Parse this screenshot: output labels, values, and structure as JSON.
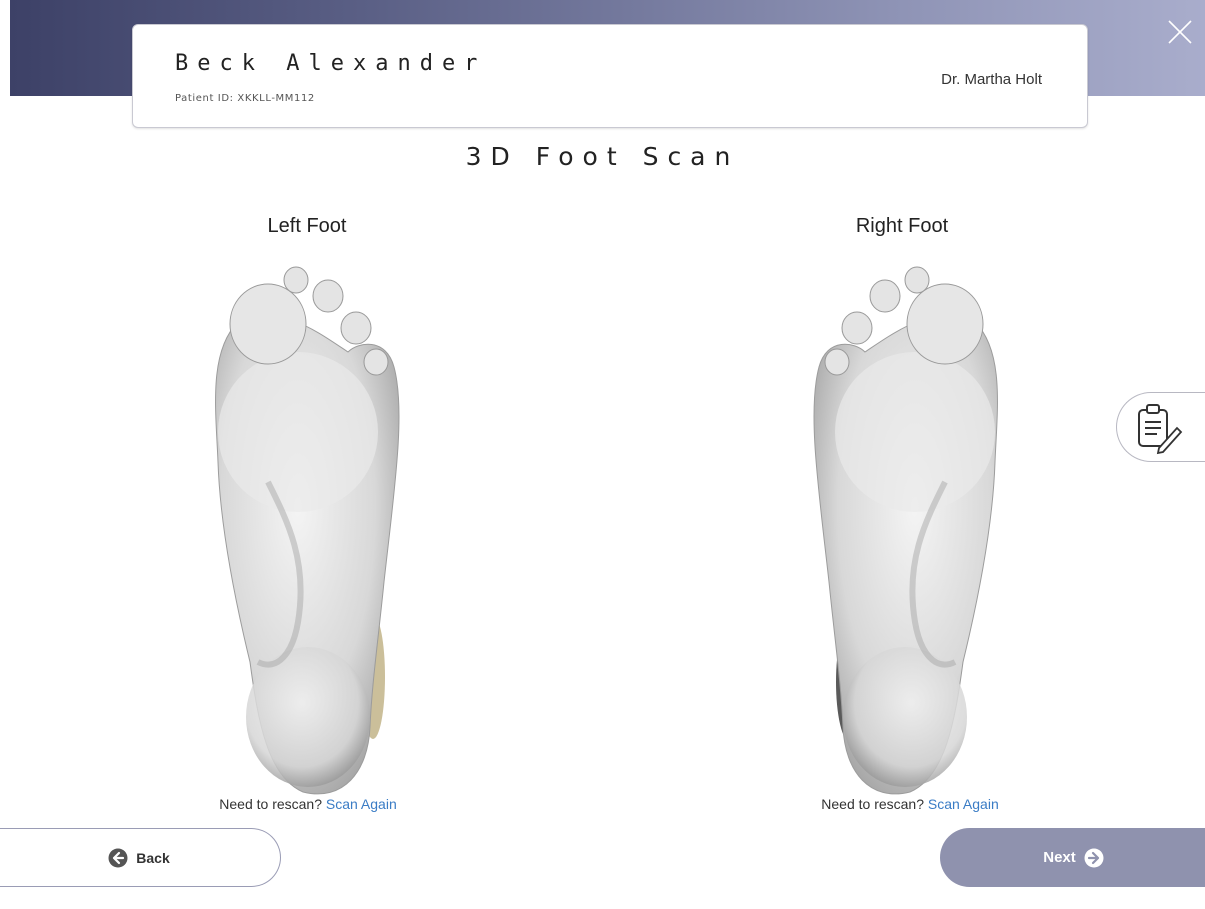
{
  "header": {
    "patient_name": "Beck Alexander",
    "patient_id": "Patient ID: XKKLL-MM112",
    "doctor": "Dr. Martha Holt",
    "close_icon": "close-icon"
  },
  "page": {
    "title": "3D Foot Scan"
  },
  "feet": {
    "left": {
      "label": "Left Foot",
      "rescan_prompt": "Need to rescan?",
      "rescan_link": "Scan Again"
    },
    "right": {
      "label": "Right Foot",
      "rescan_prompt": "Need to rescan?",
      "rescan_link": "Scan Again"
    }
  },
  "side_tab": {
    "icon": "clipboard-edit-icon"
  },
  "footer": {
    "back_label": "Back",
    "back_icon": "arrow-left-circle-icon",
    "next_label": "Next",
    "next_icon": "arrow-right-circle-icon"
  },
  "colors": {
    "header_gradient_start": "#3c4066",
    "header_gradient_end": "#a9adcc",
    "next_button": "#8f92ae",
    "link": "#3a7cc5"
  }
}
